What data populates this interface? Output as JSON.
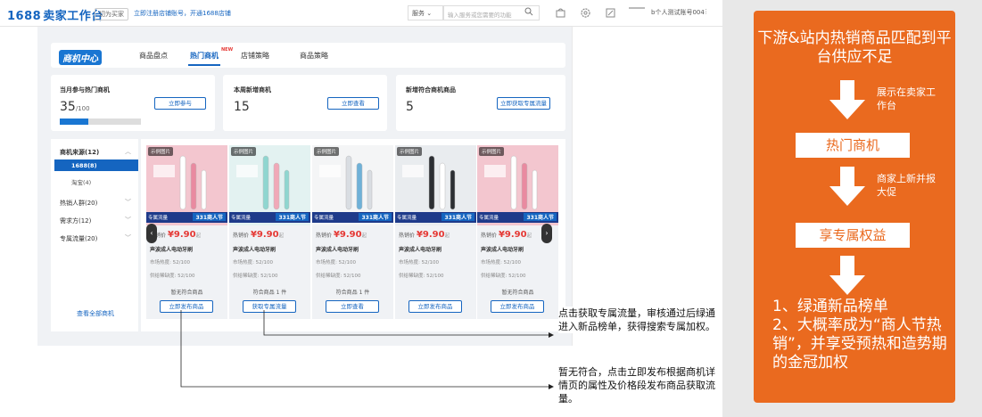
{
  "topbar": {
    "logo_num": "1688",
    "logo_text": "卖家工作台",
    "switch_label": "切为买家",
    "notice": "立即注册店铺账号，开通1688店铺",
    "service_select": "服务",
    "search_placeholder": "输入服务或您需要的功能",
    "account": "b个人测试账号004"
  },
  "tabs": {
    "logo": "商机中心",
    "items": [
      "商品盘点",
      "热门商机",
      "店铺策略",
      "商品策略"
    ],
    "new_badge": "NEW"
  },
  "stats": [
    {
      "title": "当月参与热门商机",
      "value": "35",
      "suffix": "/100",
      "button": "立即参与",
      "progress": 0.35
    },
    {
      "title": "本周新增商机",
      "value": "15",
      "suffix": "",
      "button": "立即查看"
    },
    {
      "title": "新增符合商机商品",
      "value": "5",
      "suffix": "",
      "button": "立即获取专属流量"
    }
  ],
  "filters": {
    "source": "商机来源(12)",
    "sub_items": [
      "1688(8)",
      "淘宝(4)"
    ],
    "groups": [
      "热销人群(20)",
      "需求方(12)",
      "专属流量(20)"
    ],
    "view_all": "查看全部商机"
  },
  "product_common": {
    "sample_tag": "示例图片",
    "flow_tag": "专属流量",
    "fest_tag": "331商人节",
    "price_label": "热销价",
    "price": "¥9.90",
    "price_unit": "起",
    "name": "声波成人电动牙刷",
    "metric1": "市场热度: 52/100",
    "metric2": "供给稀缺度: 52/100"
  },
  "products": [
    {
      "status": "暂无符合商品",
      "button": "立即发布商品",
      "theme": "pink"
    },
    {
      "status": "符合商品 1 件",
      "button": "获取专属流量",
      "theme": "teal"
    },
    {
      "status": "符合商品 1 件",
      "button": "立即查看",
      "theme": "white"
    },
    {
      "status": "",
      "button": "立即发布商品",
      "theme": "gray"
    },
    {
      "status": "暂无符合商品",
      "button": "立即发布商品",
      "theme": "pink"
    }
  ],
  "annotations": {
    "callout1": "点击获取专属流量，审核通过后绿通进入新品榜单，获得搜索专属加权。",
    "callout2": "暂无符合，点击立即发布根据商机详情页的属性及价格段发布商品获取流量。"
  },
  "flow": {
    "title": "下游&站内热销商品匹配到平台供应不足",
    "note1": "展示在卖家工作台",
    "box1": "热门商机",
    "note2": "商家上新并报大促",
    "box2": "享专属权益",
    "benefits": "1、绿通新品榜单\n2、大概率成为“商人节热销”，并享受预热和造势期的金冠加权"
  },
  "colors": {
    "brand_blue": "#1565c0",
    "orange": "#ea6a1f",
    "price_red": "#e53935"
  }
}
